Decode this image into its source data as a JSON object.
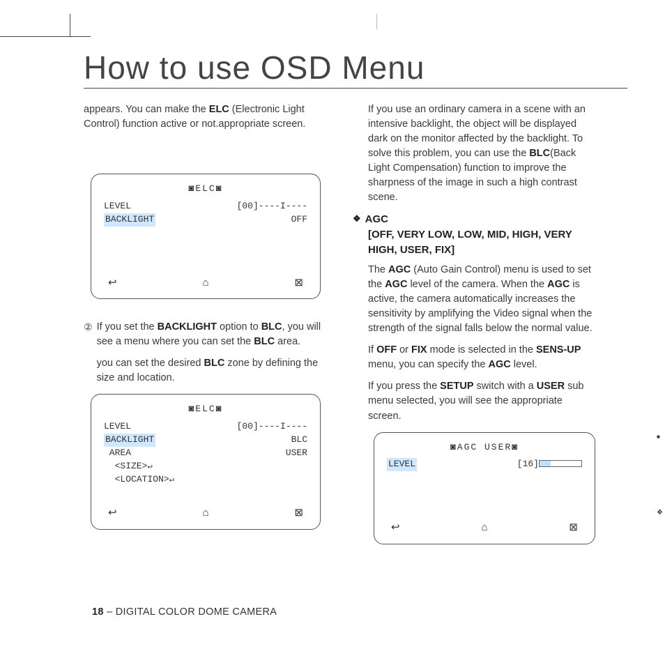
{
  "pageTitle": "How to use OSD Menu",
  "footer": {
    "pageNum": "18",
    "doc": " – DIGITAL COLOR DOME CAMERA"
  },
  "left": {
    "p1a": "appears. You can make the ",
    "p1b": "ELC",
    "p1c": " (Electronic Light Control) function active or not.appropriate screen.",
    "osd1": {
      "title": "◙ELC◙",
      "level": "LEVEL",
      "levelVal": "[00]----I----",
      "backlight": "BACKLIGHT",
      "backlightVal": "OFF"
    },
    "step2num": "②",
    "step2a": "If you set the ",
    "step2b": "BACKLIGHT",
    "step2c": " option to ",
    "step2d": "BLC",
    "step2e": ", you will see a menu where you can set the ",
    "step2f": "BLC",
    "step2g": " area.",
    "step2h": "you can set the desired ",
    "step2i": "BLC",
    "step2j": " zone by defining the size and location.",
    "osd2": {
      "title": "◙ELC◙",
      "level": "LEVEL",
      "levelVal": "[00]----I----",
      "backlight": "BACKLIGHT",
      "backlightVal": "BLC",
      "area": " AREA",
      "areaVal": "USER",
      "size": "  <SIZE>",
      "location": "  <LOCATION>"
    }
  },
  "right": {
    "p1a": "If you use an ordinary camera in a scene with an intensive backlight, the object will be displayed dark on the monitor affected by the backlight. To solve this problem, you can use the ",
    "p1b": "BLC",
    "p1c": "(Back Light Compensation) function to improve the sharpness of the image in such a high contrast scene.",
    "agcHead": "AGC",
    "agcSub": "[OFF, VERY LOW, LOW, MID, HIGH, VERY HIGH, USER, FIX]",
    "p2a": "The ",
    "p2b": "AGC",
    "p2c": " (Auto Gain Control) menu is used to set the ",
    "p2d": "AGC",
    "p2e": " level of the camera. When the ",
    "p2f": "AGC",
    "p2g": " is active, the camera automatically increases the sensitivity by amplifying the Video signal when the strength of the signal falls below the normal value.",
    "p3a": "If ",
    "p3b": "OFF",
    "p3c": " or ",
    "p3d": "FIX",
    "p3e": " mode is selected in the ",
    "p3f": "SENS-UP",
    "p3g": " menu, you can specify the ",
    "p3h": "AGC",
    "p3i": " level.",
    "p4a": "If you press the ",
    "p4b": "SETUP",
    "p4c": " switch with a ",
    "p4d": "USER",
    "p4e": " sub menu selected, you will see the appropriate screen.",
    "osd3": {
      "title": "◙AGC USER◙",
      "level": "LEVEL",
      "levelVal": "[16]"
    }
  },
  "icons": {
    "back": "↩",
    "home": "⌂",
    "close": "⊠"
  }
}
